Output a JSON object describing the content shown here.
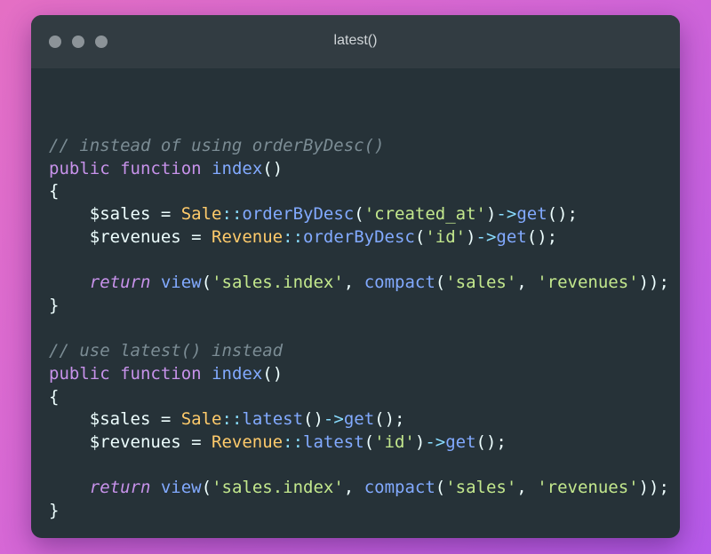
{
  "window": {
    "title": "latest()",
    "buttons": [
      "close-dot",
      "minimize-dot",
      "maximize-dot"
    ]
  },
  "code": {
    "language": "php",
    "lines": [
      [
        {
          "t": "// instead of using orderByDesc()",
          "k": "comment"
        }
      ],
      [
        {
          "t": "public",
          "k": "kw"
        },
        {
          "t": " ",
          "k": "punc"
        },
        {
          "t": "function",
          "k": "kw"
        },
        {
          "t": " ",
          "k": "punc"
        },
        {
          "t": "index",
          "k": "fn"
        },
        {
          "t": "()",
          "k": "punc"
        }
      ],
      [
        {
          "t": "{",
          "k": "punc"
        }
      ],
      [
        {
          "t": "    ",
          "k": "punc"
        },
        {
          "t": "$sales",
          "k": "var"
        },
        {
          "t": " = ",
          "k": "punc"
        },
        {
          "t": "Sale",
          "k": "class"
        },
        {
          "t": "::",
          "k": "op"
        },
        {
          "t": "orderByDesc",
          "k": "fn"
        },
        {
          "t": "(",
          "k": "punc"
        },
        {
          "t": "'created_at'",
          "k": "str"
        },
        {
          "t": ")",
          "k": "punc"
        },
        {
          "t": "->",
          "k": "op"
        },
        {
          "t": "get",
          "k": "fn"
        },
        {
          "t": "();",
          "k": "punc"
        }
      ],
      [
        {
          "t": "    ",
          "k": "punc"
        },
        {
          "t": "$revenues",
          "k": "var"
        },
        {
          "t": " = ",
          "k": "punc"
        },
        {
          "t": "Revenue",
          "k": "class"
        },
        {
          "t": "::",
          "k": "op"
        },
        {
          "t": "orderByDesc",
          "k": "fn"
        },
        {
          "t": "(",
          "k": "punc"
        },
        {
          "t": "'id'",
          "k": "str"
        },
        {
          "t": ")",
          "k": "punc"
        },
        {
          "t": "->",
          "k": "op"
        },
        {
          "t": "get",
          "k": "fn"
        },
        {
          "t": "();",
          "k": "punc"
        }
      ],
      [],
      [
        {
          "t": "    ",
          "k": "punc"
        },
        {
          "t": "return",
          "k": "kw-i"
        },
        {
          "t": " ",
          "k": "punc"
        },
        {
          "t": "view",
          "k": "fn"
        },
        {
          "t": "(",
          "k": "punc"
        },
        {
          "t": "'sales.index'",
          "k": "str"
        },
        {
          "t": ", ",
          "k": "punc"
        },
        {
          "t": "compact",
          "k": "fn"
        },
        {
          "t": "(",
          "k": "punc"
        },
        {
          "t": "'sales'",
          "k": "str"
        },
        {
          "t": ", ",
          "k": "punc"
        },
        {
          "t": "'revenues'",
          "k": "str"
        },
        {
          "t": "));",
          "k": "punc"
        }
      ],
      [
        {
          "t": "}",
          "k": "punc"
        }
      ],
      [],
      [
        {
          "t": "// use latest() instead",
          "k": "comment"
        }
      ],
      [
        {
          "t": "public",
          "k": "kw"
        },
        {
          "t": " ",
          "k": "punc"
        },
        {
          "t": "function",
          "k": "kw"
        },
        {
          "t": " ",
          "k": "punc"
        },
        {
          "t": "index",
          "k": "fn"
        },
        {
          "t": "()",
          "k": "punc"
        }
      ],
      [
        {
          "t": "{",
          "k": "punc"
        }
      ],
      [
        {
          "t": "    ",
          "k": "punc"
        },
        {
          "t": "$sales",
          "k": "var"
        },
        {
          "t": " = ",
          "k": "punc"
        },
        {
          "t": "Sale",
          "k": "class"
        },
        {
          "t": "::",
          "k": "op"
        },
        {
          "t": "latest",
          "k": "fn"
        },
        {
          "t": "()",
          "k": "punc"
        },
        {
          "t": "->",
          "k": "op"
        },
        {
          "t": "get",
          "k": "fn"
        },
        {
          "t": "();",
          "k": "punc"
        }
      ],
      [
        {
          "t": "    ",
          "k": "punc"
        },
        {
          "t": "$revenues",
          "k": "var"
        },
        {
          "t": " = ",
          "k": "punc"
        },
        {
          "t": "Revenue",
          "k": "class"
        },
        {
          "t": "::",
          "k": "op"
        },
        {
          "t": "latest",
          "k": "fn"
        },
        {
          "t": "(",
          "k": "punc"
        },
        {
          "t": "'id'",
          "k": "str"
        },
        {
          "t": ")",
          "k": "punc"
        },
        {
          "t": "->",
          "k": "op"
        },
        {
          "t": "get",
          "k": "fn"
        },
        {
          "t": "();",
          "k": "punc"
        }
      ],
      [],
      [
        {
          "t": "    ",
          "k": "punc"
        },
        {
          "t": "return",
          "k": "kw-i"
        },
        {
          "t": " ",
          "k": "punc"
        },
        {
          "t": "view",
          "k": "fn"
        },
        {
          "t": "(",
          "k": "punc"
        },
        {
          "t": "'sales.index'",
          "k": "str"
        },
        {
          "t": ", ",
          "k": "punc"
        },
        {
          "t": "compact",
          "k": "fn"
        },
        {
          "t": "(",
          "k": "punc"
        },
        {
          "t": "'sales'",
          "k": "str"
        },
        {
          "t": ", ",
          "k": "punc"
        },
        {
          "t": "'revenues'",
          "k": "str"
        },
        {
          "t": "));",
          "k": "punc"
        }
      ],
      [
        {
          "t": "}",
          "k": "punc"
        }
      ]
    ]
  },
  "colors": {
    "background_gradient": [
      "#e46fc4",
      "#b65ae9"
    ],
    "window_bg": "#263238",
    "titlebar_bg": "#323c42",
    "comment": "#7b8c94",
    "keyword": "#c792ea",
    "function": "#82aaff",
    "class": "#ffcb6b",
    "string": "#c3e88d",
    "operator": "#89ddff",
    "text": "#eeffff"
  }
}
